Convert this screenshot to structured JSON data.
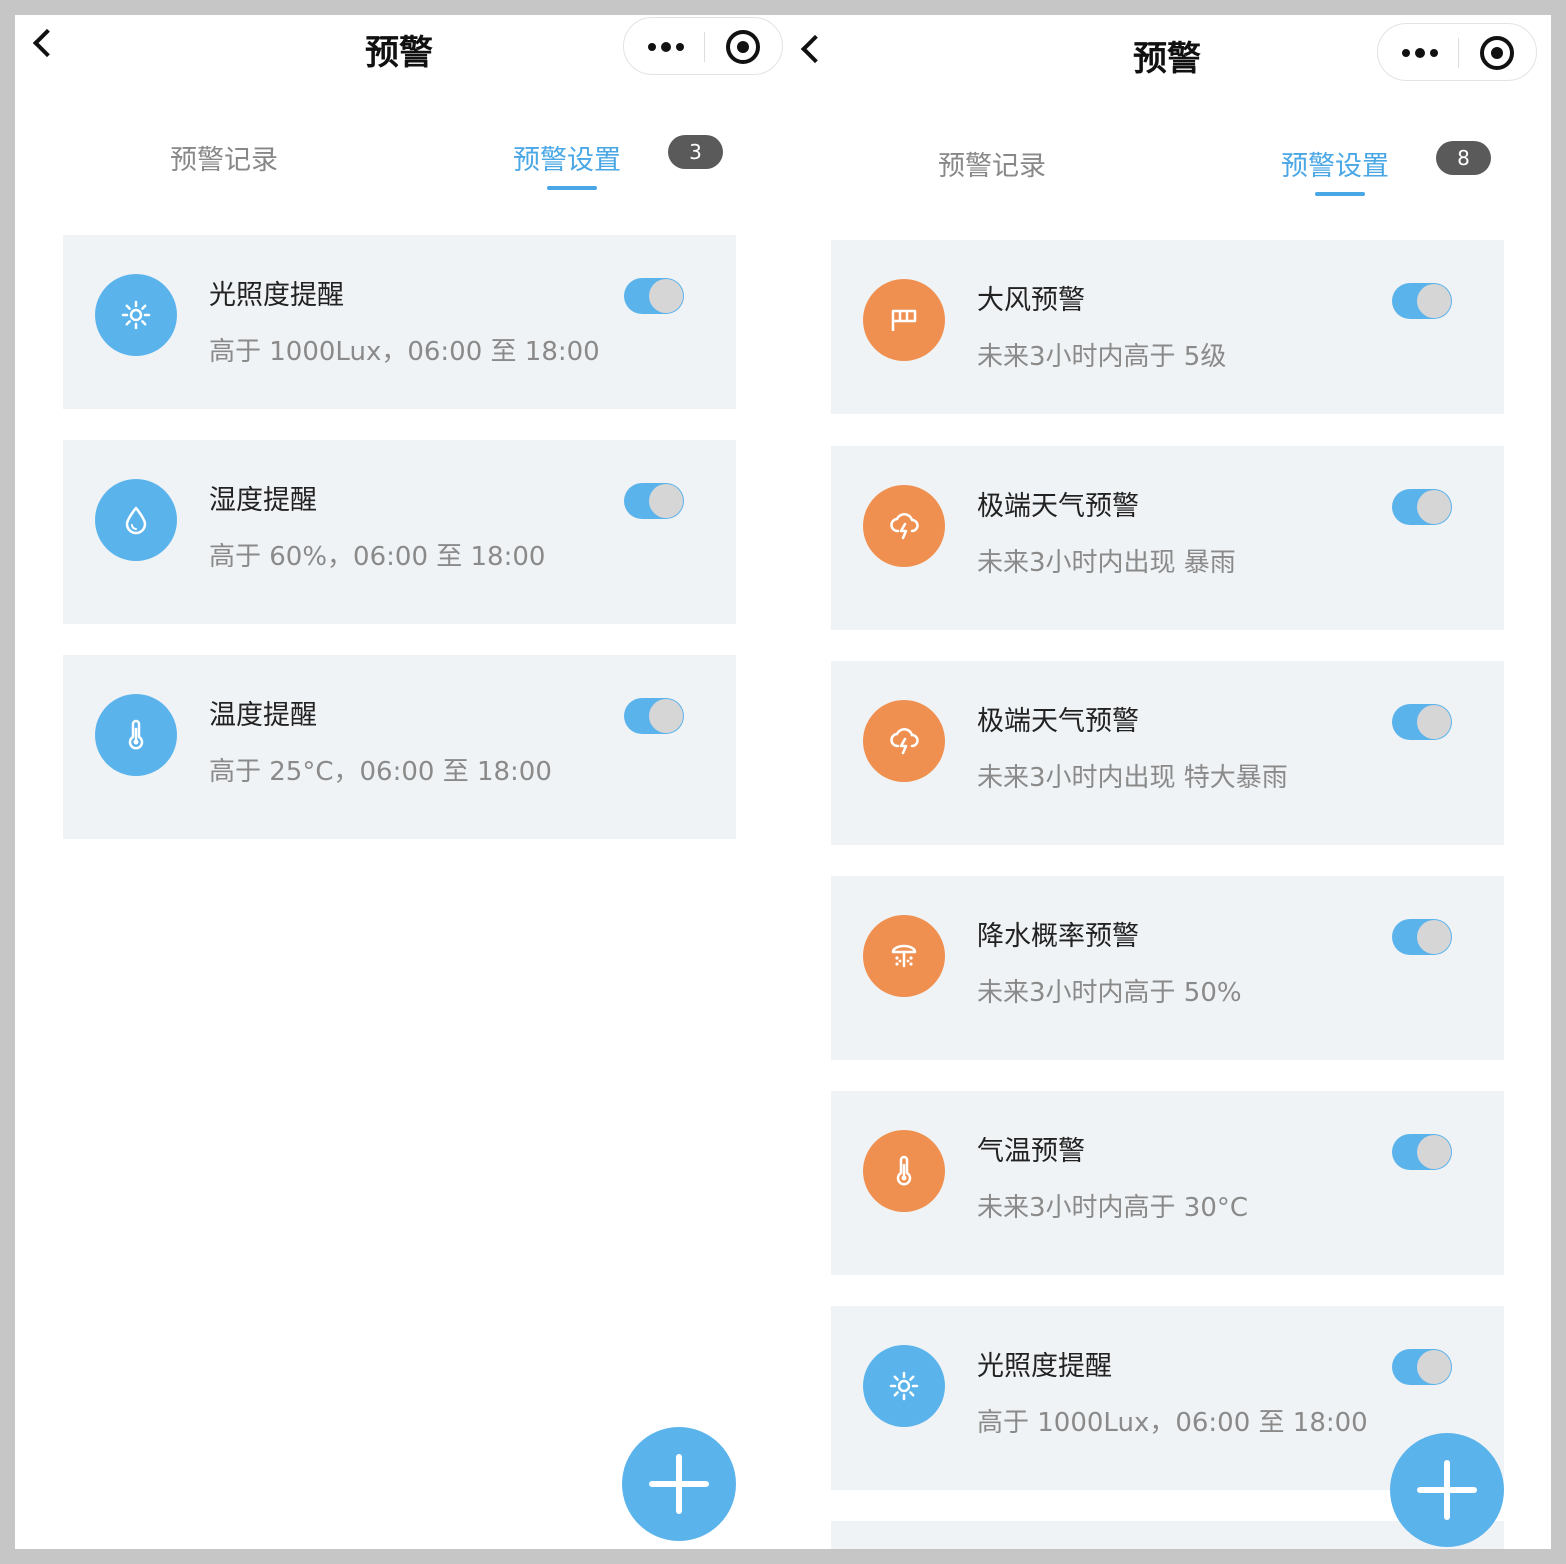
{
  "left": {
    "nav": {
      "title": "预警"
    },
    "tabs": {
      "records": "预警记录",
      "settings": "预警设置",
      "badge": "3"
    },
    "cards": [
      {
        "title": "光照度提醒",
        "desc": "高于 1000Lux，06:00 至 18:00",
        "icon": "sun-icon",
        "color": "#5bb3ec",
        "enabled": true
      },
      {
        "title": "湿度提醒",
        "desc": "高于 60%，06:00 至 18:00",
        "icon": "water-drop-icon",
        "color": "#5bb3ec",
        "enabled": true
      },
      {
        "title": "温度提醒",
        "desc": "高于 25°C，06:00 至 18:00",
        "icon": "thermometer-icon",
        "color": "#5bb3ec",
        "enabled": true
      }
    ]
  },
  "right": {
    "nav": {
      "title": "预警"
    },
    "tabs": {
      "records": "预警记录",
      "settings": "预警设置",
      "badge": "8"
    },
    "cards": [
      {
        "title": "大风预警",
        "desc": "未来3小时内高于 5级",
        "icon": "wind-flag-icon",
        "color": "#ef9050",
        "enabled": true
      },
      {
        "title": "极端天气预警",
        "desc": "未来3小时内出现 暴雨",
        "icon": "storm-cloud-icon",
        "color": "#ef9050",
        "enabled": true
      },
      {
        "title": "极端天气预警",
        "desc": "未来3小时内出现 特大暴雨",
        "icon": "storm-cloud-icon",
        "color": "#ef9050",
        "enabled": true
      },
      {
        "title": "降水概率预警",
        "desc": "未来3小时内高于 50%",
        "icon": "rain-probability-icon",
        "color": "#ef9050",
        "enabled": true
      },
      {
        "title": "气温预警",
        "desc": "未来3小时内高于 30°C",
        "icon": "thermometer-icon",
        "color": "#ef9050",
        "enabled": true
      },
      {
        "title": "光照度提醒",
        "desc": "高于 1000Lux，06:00 至 18:00",
        "icon": "sun-icon",
        "color": "#5bb3ec",
        "enabled": true
      }
    ]
  }
}
